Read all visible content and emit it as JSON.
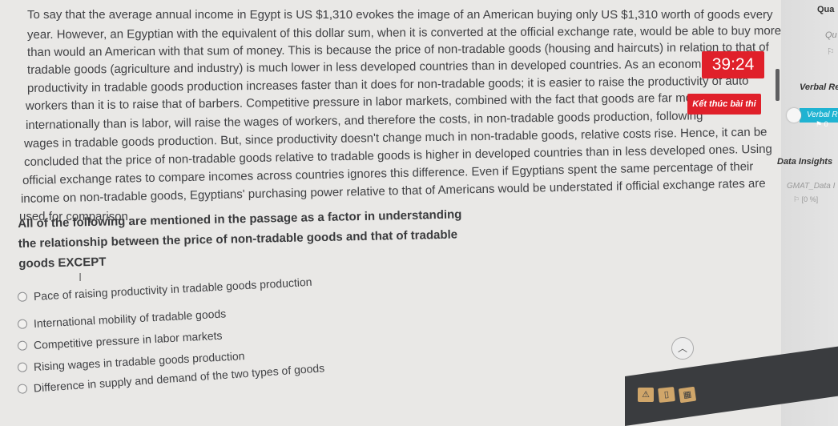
{
  "passage": {
    "lines": [
      "To say that the average annual income in Egypt is US $1,310 evokes the image of an American buying only US $1,310 worth of goods every",
      "year. However, an Egyptian with the equivalent of this dollar sum, when it is converted at the official exchange rate, would be able to buy more",
      "than would an American with that sum of money. This is because the price of non-tradable goods (housing and haircuts) in relation to that of",
      "tradable goods (agriculture and industry) is much lower in less developed countries than in developed countries. As an econom",
      "productivity in tradable goods production increases faster than it does for non-tradable goods; it is easier to raise the productivity of auto",
      "workers than it is to raise that of barbers. Competitive pressure in labor markets, combined with the fact that goods are far more",
      "internationally than is labor, will raise the wages of workers, and therefore the costs, in non-tradable goods production, following",
      "wages in tradable goods production. But, since productivity doesn't change much in non-tradable goods, relative costs rise. Hence, it can be",
      "concluded that the price of non-tradable goods relative to tradable goods is higher in developed countries than in less developed ones. Using",
      "official exchange rates to compare incomes across countries ignores this difference. Even if Egyptians spent the same percentage of their",
      "income on non-tradable goods, Egyptians' purchasing power relative to that of Americans would be understated if official exchange rates are",
      "used for comparison."
    ]
  },
  "question": {
    "text": "All of the following are mentioned in the passage as a factor in understanding the relationship between the price of non-tradable goods and that of tradable goods EXCEPT",
    "options": [
      "Pace of raising productivity in tradable goods production",
      "International mobility of tradable goods",
      "Competitive pressure in labor markets",
      "Rising wages in tradable goods production",
      "Difference in supply and demand of the two types of goods"
    ]
  },
  "timer": {
    "value": "39:24",
    "color": "#e0202a"
  },
  "submit_button": {
    "label": "Kết thúc bài thi"
  },
  "sidebar": {
    "section1_title": "Qua",
    "section1_sub": "Qu",
    "section2_title": "Verbal Re",
    "section2_tag": "Verbal R",
    "section2_count": "0",
    "section3_title": "Data Insights",
    "section3_sub": "GMAT_Data I",
    "section3_count": "[0 %]",
    "accent": "#1fb3d2"
  },
  "scroll_up": {
    "icon": "chevron-up-icon"
  }
}
